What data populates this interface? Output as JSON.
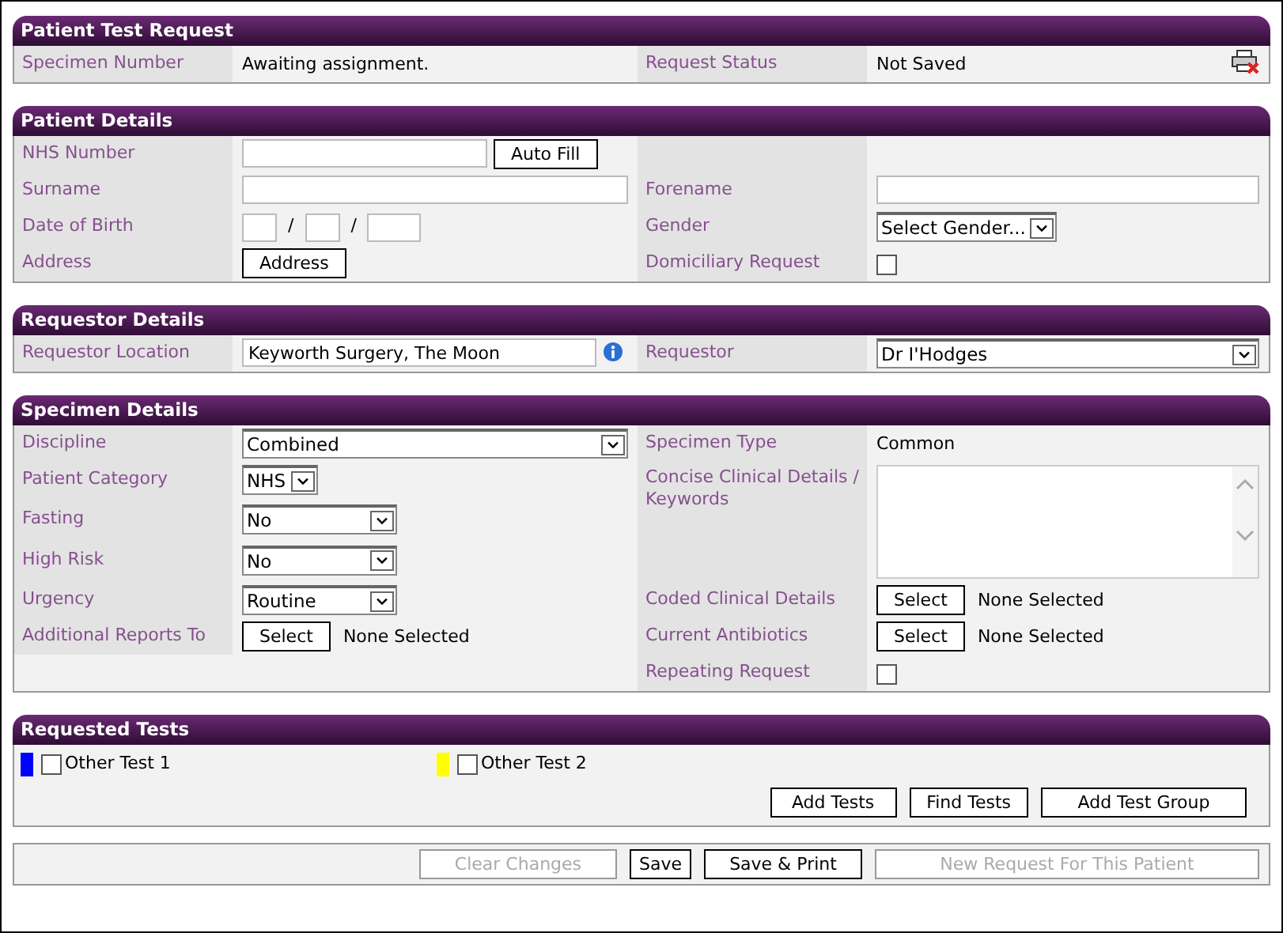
{
  "sections": [
    {
      "title": "Patient Test Request",
      "rows": [
        {
          "left": {
            "label": "Specimen Number",
            "field": {
              "kind": "text",
              "value": "Awaiting assignment."
            }
          },
          "right": {
            "label": "Request Status",
            "field": {
              "kind": "status",
              "value": "Not Saved"
            }
          }
        }
      ]
    },
    {
      "title": "Patient Details",
      "rows": [
        {
          "left": {
            "label": "NHS Number",
            "field": {
              "kind": "input_button",
              "button": "Auto Fill"
            }
          }
        },
        {
          "left": {
            "label": "Surname",
            "field": {
              "kind": "input"
            }
          },
          "right": {
            "label": "Forename",
            "field": {
              "kind": "input"
            }
          }
        },
        {
          "left": {
            "label": "Date of Birth",
            "field": {
              "kind": "date",
              "separators": [
                "/",
                "/"
              ]
            }
          },
          "right": {
            "label": "Gender",
            "field": {
              "kind": "select_fit",
              "value": "Select Gender..."
            }
          }
        },
        {
          "left": {
            "label": "Address",
            "field": {
              "kind": "button",
              "button": "Address"
            }
          },
          "right": {
            "label": "Domiciliary Request",
            "field": {
              "kind": "checkbox",
              "checked": false
            }
          }
        }
      ]
    },
    {
      "title": "Requestor Details",
      "rows": [
        {
          "left": {
            "label": "Requestor Location",
            "field": {
              "kind": "input_info",
              "value": "Keyworth Surgery, The Moon"
            }
          },
          "right": {
            "label": "Requestor",
            "field": {
              "kind": "select_wide",
              "value": "Dr I'Hodges"
            }
          }
        }
      ]
    },
    {
      "title": "Specimen Details",
      "rows": [
        {
          "left": {
            "label": "Discipline",
            "field": {
              "kind": "select_wide",
              "value": "Combined"
            }
          },
          "right": {
            "label": "Specimen Type",
            "field": {
              "kind": "text",
              "value": "Common"
            }
          }
        },
        {
          "left": {
            "label": "Patient Category",
            "field": {
              "kind": "select_fit",
              "value": "NHS"
            }
          },
          "right": {
            "label": "Concise Clinical Details / Keywords",
            "field": {
              "kind": "textarea"
            }
          }
        },
        {
          "left": {
            "label": "Fasting",
            "field": {
              "kind": "select",
              "value": "No"
            }
          }
        },
        {
          "left": {
            "label": "High Risk",
            "field": {
              "kind": "select",
              "value": "No"
            }
          }
        },
        {
          "left": {
            "label": "Urgency",
            "field": {
              "kind": "select",
              "value": "Routine"
            }
          },
          "right": {
            "label": "Coded Clinical Details",
            "field": {
              "kind": "button_text",
              "button": "Select",
              "value": "None Selected"
            }
          }
        },
        {
          "left": {
            "label": "Additional Reports To",
            "field": {
              "kind": "button_text",
              "button": "Select",
              "value": "None Selected"
            }
          },
          "right": {
            "label": "Current Antibiotics",
            "field": {
              "kind": "button_text",
              "button": "Select",
              "value": "None Selected"
            }
          }
        },
        {
          "right": {
            "label": "Repeating Request",
            "field": {
              "kind": "checkbox",
              "checked": false
            }
          }
        }
      ]
    }
  ],
  "requested_tests": {
    "title": "Requested Tests",
    "tests": [
      {
        "label": "Other Test 1",
        "color": "#0000ff",
        "checked": false
      },
      {
        "label": "Other Test 2",
        "color": "#ffff00",
        "checked": false
      }
    ],
    "buttons": [
      "Add Tests",
      "Find Tests",
      "Add Test Group"
    ]
  },
  "footer_buttons": [
    {
      "label": "Clear Changes",
      "disabled": true
    },
    {
      "label": "Save",
      "disabled": false
    },
    {
      "label": "Save & Print",
      "disabled": false
    },
    {
      "label": "New Request For This Patient",
      "disabled": true
    }
  ]
}
